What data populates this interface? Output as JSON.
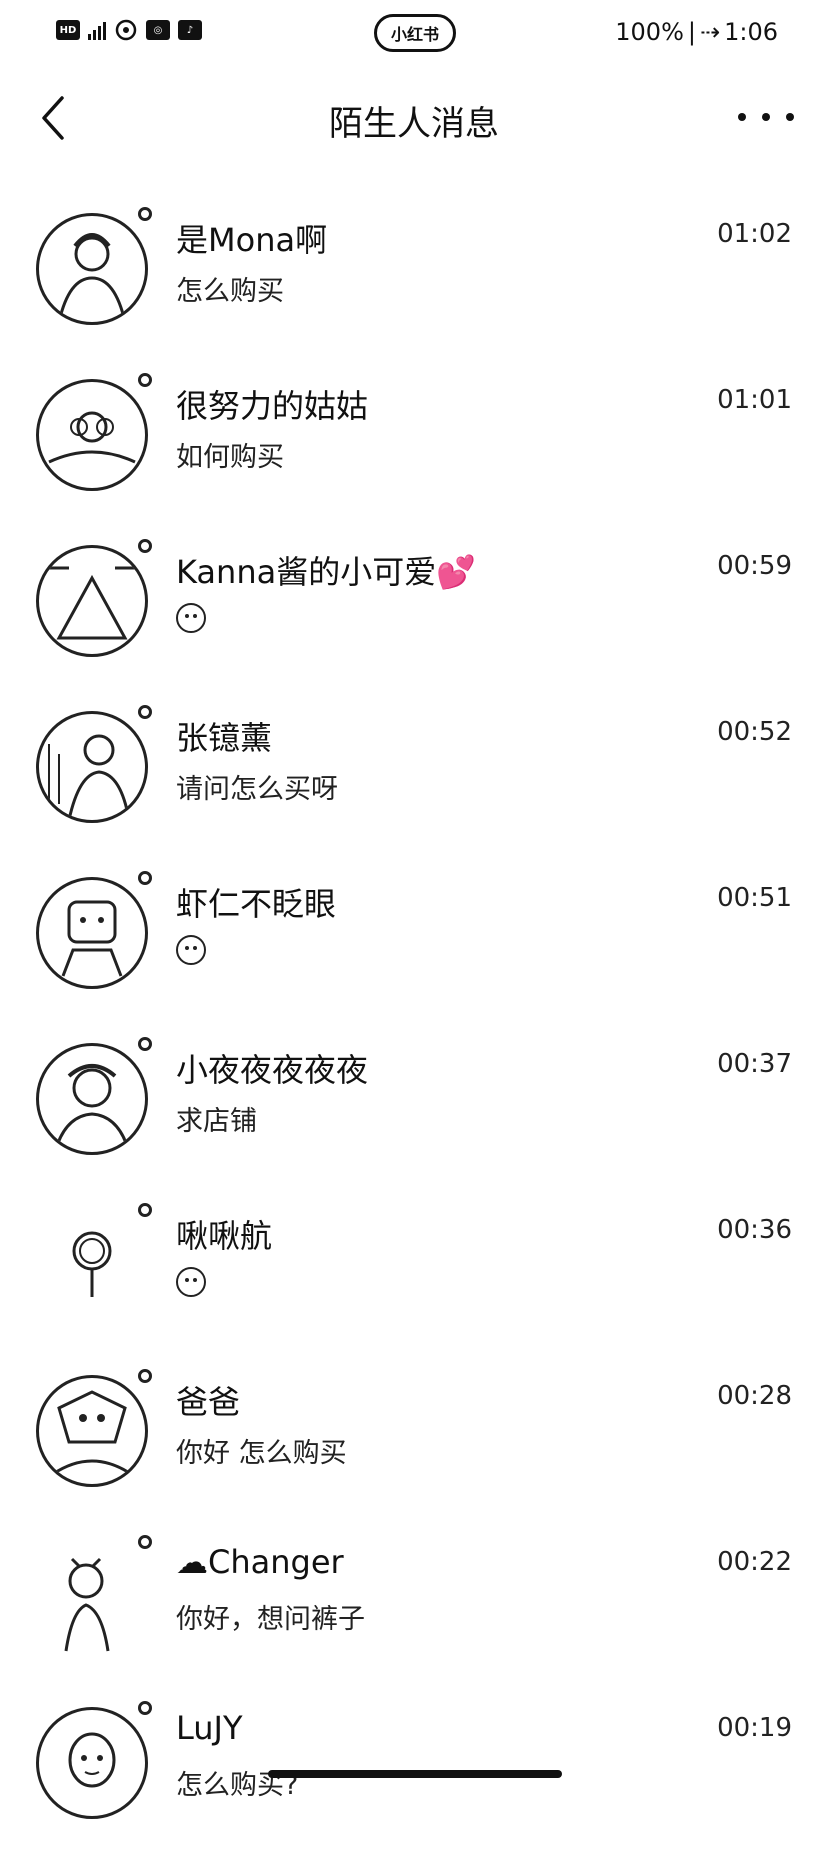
{
  "status_bar": {
    "left_badges": [
      "HD",
      "4G",
      "HD"
    ],
    "center_label": "小红书",
    "battery": "100%",
    "time": "1:06"
  },
  "nav": {
    "title": "陌生人消息"
  },
  "messages": [
    {
      "name": "是Mona啊",
      "preview": "怎么购买",
      "time": "01:02",
      "avatar_icon": "girl-portrait-icon"
    },
    {
      "name": "很努力的姑姑",
      "preview": "如何购买",
      "time": "01:01",
      "avatar_icon": "flower-scene-icon"
    },
    {
      "name": "Kanna酱的小可爱",
      "name_suffix": "💕",
      "preview": "",
      "preview_icon": "emoji-face-icon",
      "time": "00:59",
      "avatar_icon": "scenery-icon"
    },
    {
      "name": "张镱薰",
      "preview": "请问怎么买呀",
      "time": "00:52",
      "avatar_icon": "girl-portrait-icon"
    },
    {
      "name": "虾仁不眨眼",
      "preview": "",
      "preview_icon": "emoji-face-icon",
      "time": "00:51",
      "avatar_icon": "cartoon-icon"
    },
    {
      "name": "小夜夜夜夜夜",
      "preview": "求店铺",
      "time": "00:37",
      "avatar_icon": "girl-portrait-icon"
    },
    {
      "name": "啾啾航",
      "preview": "",
      "preview_icon": "emoji-face-icon",
      "time": "00:36",
      "avatar_icon": "pin-icon"
    },
    {
      "name": "爸爸",
      "preview": "你好 怎么购买",
      "time": "00:28",
      "avatar_icon": "cartoon-icon"
    },
    {
      "name": "Changer",
      "name_prefix": "☁",
      "preview": "你好，想问裤子",
      "time": "00:22",
      "avatar_icon": "girl-portrait-icon"
    },
    {
      "name": "LuJY",
      "preview": "怎么购买?",
      "time": "00:19",
      "avatar_icon": "girl-portrait-icon"
    }
  ]
}
